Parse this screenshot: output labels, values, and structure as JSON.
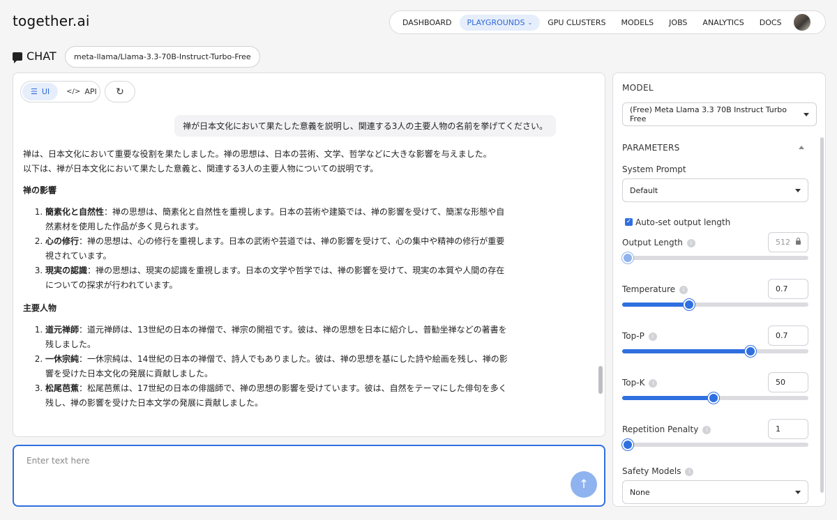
{
  "app": {
    "logo": "together.ai"
  },
  "nav": {
    "items": [
      {
        "label": "DASHBOARD",
        "active": false
      },
      {
        "label": "PLAYGROUNDS",
        "active": true
      },
      {
        "label": "GPU CLUSTERS",
        "active": false
      },
      {
        "label": "MODELS",
        "active": false
      },
      {
        "label": "JOBS",
        "active": false
      },
      {
        "label": "ANALYTICS",
        "active": false
      },
      {
        "label": "DOCS",
        "active": false
      }
    ]
  },
  "chat": {
    "label": "CHAT",
    "model_pill": "meta-llama/Llama-3.3-70B-Instruct-Turbo-Free",
    "mode_ui": "UI",
    "mode_api": "API",
    "user_message": "禅が日本文化において果たした意義を説明し、関連する3人の主要人物の名前を挙げてください。",
    "answer": {
      "intro1": "禅は、日本文化において重要な役割を果たしました。禅の思想は、日本の芸術、文学、哲学などに大きな影響を与えました。",
      "intro2": "以下は、禅が日本文化において果たした意義と、関連する3人の主要人物についての説明です。",
      "section1_title": "禅の影響",
      "section1_items": [
        {
          "term": "簡素化と自然性",
          "text": "：禅の思想は、簡素化と自然性を重視します。日本の芸術や建築では、禅の影響を受けて、簡潔な形態や自然素材を使用した作品が多く見られます。"
        },
        {
          "term": "心の修行",
          "text": "：禅の思想は、心の修行を重視します。日本の武術や芸道では、禅の影響を受けて、心の集中や精神の修行が重要視されています。"
        },
        {
          "term": "現実の認識",
          "text": "：禅の思想は、現実の認識を重視します。日本の文学や哲学では、禅の影響を受けて、現実の本質や人間の存在についての探求が行われています。"
        }
      ],
      "section2_title": "主要人物",
      "section2_items": [
        {
          "term": "道元禅師",
          "text": "：道元禅師は、13世紀の日本の禅僧で、禅宗の開祖です。彼は、禅の思想を日本に紹介し、普勧坐禅などの著書を残しました。"
        },
        {
          "term": "一休宗純",
          "text": "：一休宗純は、14世紀の日本の禅僧で、詩人でもありました。彼は、禅の思想を基にした詩や絵画を残し、禅の影響を受けた日本文化の発展に貢献しました。"
        },
        {
          "term": "松尾芭蕉",
          "text": "：松尾芭蕉は、17世紀の日本の俳諧師で、禅の思想の影響を受けています。彼は、自然をテーマにした俳句を多く残し、禅の影響を受けた日本文学の発展に貢献しました。"
        }
      ]
    },
    "input_placeholder": "Enter text here",
    "input_value": ""
  },
  "settings": {
    "model_title": "MODEL",
    "model_value": "(Free) Meta Llama 3.3 70B Instruct Turbo Free",
    "parameters_title": "PARAMETERS",
    "system_prompt_label": "System Prompt",
    "system_prompt_value": "Default",
    "auto_output_label": "Auto-set output length",
    "output_length": {
      "label": "Output Length",
      "value": "512",
      "fraction": 0.03
    },
    "temperature": {
      "label": "Temperature",
      "value": "0.7",
      "fraction": 0.36
    },
    "top_p": {
      "label": "Top-P",
      "value": "0.7",
      "fraction": 0.69
    },
    "top_k": {
      "label": "Top-K",
      "value": "50",
      "fraction": 0.49
    },
    "repetition_penalty": {
      "label": "Repetition Penalty",
      "value": "1",
      "fraction": 0.03
    },
    "safety_models_label": "Safety Models",
    "safety_models_value": "None"
  },
  "icons": {
    "chat": "chat-bubble-icon",
    "ui": "sliders-icon",
    "api": "code-icon",
    "refresh": "refresh-icon",
    "send": "arrow-up-icon",
    "lock": "lock-icon",
    "info": "info-icon"
  },
  "colors": {
    "accent": "#2f6fe0",
    "accent_light": "#e6eefb",
    "send_disabled": "#8fb3ef"
  }
}
